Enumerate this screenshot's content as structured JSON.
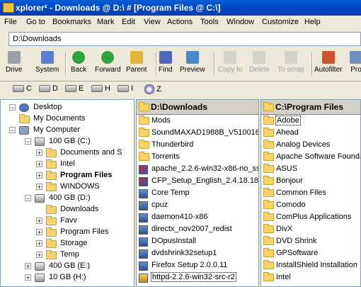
{
  "window": {
    "title": "xplorer² - Downloads @ D:\\ # [Program Files @ C:\\]"
  },
  "menu": [
    "File",
    "Go to",
    "Bookmarks",
    "Mark",
    "Edit",
    "View",
    "Actions",
    "Tools",
    "Window",
    "Customize",
    "Help"
  ],
  "address": {
    "value": "D:\\Downloads"
  },
  "toolbar": [
    {
      "label": "Drive",
      "icon": "drive-icon",
      "enabled": true
    },
    {
      "label": "System",
      "icon": "system-icon",
      "enabled": true
    },
    {
      "label": "Back",
      "icon": "back-arrow-icon",
      "enabled": true
    },
    {
      "label": "Forward",
      "icon": "forward-arrow-icon",
      "enabled": true
    },
    {
      "label": "Parent",
      "icon": "parent-folder-icon",
      "enabled": true
    },
    {
      "label": "Find",
      "icon": "binoculars-icon",
      "enabled": true
    },
    {
      "label": "Preview",
      "icon": "preview-icon",
      "enabled": true
    },
    {
      "label": "Copy to",
      "icon": "copy-to-icon",
      "enabled": false
    },
    {
      "label": "Delete",
      "icon": "delete-icon",
      "enabled": false
    },
    {
      "label": "To scrap",
      "icon": "scrap-icon",
      "enabled": false
    },
    {
      "label": "Autofilter",
      "icon": "filter-funnel-icon",
      "enabled": true
    },
    {
      "label": "Pro",
      "icon": "properties-icon",
      "enabled": true
    }
  ],
  "drives": [
    "C",
    "D",
    "E",
    "H",
    "I",
    "Z"
  ],
  "tree": [
    {
      "label": "Desktop",
      "level": 0,
      "expander": "−",
      "icon": "desktop-icon"
    },
    {
      "label": "My Documents",
      "level": 1,
      "expander": "",
      "icon": "folder-icon"
    },
    {
      "label": "My Computer",
      "level": 1,
      "expander": "−",
      "icon": "computer-icon"
    },
    {
      "label": "100 GB (C:)",
      "level": 2,
      "expander": "−",
      "icon": "drive-icon"
    },
    {
      "label": "Documents and S",
      "level": 3,
      "expander": "+",
      "icon": "folder-icon"
    },
    {
      "label": "Intel",
      "level": 3,
      "expander": "+",
      "icon": "folder-icon"
    },
    {
      "label": "Program Files",
      "level": 3,
      "expander": "+",
      "icon": "folder-icon",
      "bold": true
    },
    {
      "label": "WINDOWS",
      "level": 3,
      "expander": "+",
      "icon": "folder-icon"
    },
    {
      "label": "400 GB (D:)",
      "level": 2,
      "expander": "−",
      "icon": "drive-icon"
    },
    {
      "label": "Downloads",
      "level": 3,
      "expander": "",
      "icon": "folder-icon"
    },
    {
      "label": "Favv",
      "level": 3,
      "expander": "+",
      "icon": "folder-icon"
    },
    {
      "label": "Program Files",
      "level": 3,
      "expander": "+",
      "icon": "folder-icon"
    },
    {
      "label": "Storage",
      "level": 3,
      "expander": "+",
      "icon": "folder-icon"
    },
    {
      "label": "Temp",
      "level": 3,
      "expander": "+",
      "icon": "folder-icon"
    },
    {
      "label": "400 GB (E:)",
      "level": 2,
      "expander": "+",
      "icon": "drive-icon"
    },
    {
      "label": "10 GB (H:)",
      "level": 2,
      "expander": "+",
      "icon": "drive-icon"
    }
  ],
  "mid_pane": {
    "header": "D:\\Downloads",
    "items": [
      {
        "name": "Mods",
        "icon": "folder"
      },
      {
        "name": "SoundMAXAD1988B_V5100161:",
        "icon": "folder"
      },
      {
        "name": "Thunderbird",
        "icon": "folder"
      },
      {
        "name": "Torrents",
        "icon": "folder"
      },
      {
        "name": "apache_2.2.6-win32-x86-no_ss",
        "icon": "installer"
      },
      {
        "name": "CFP_Setup_English_2.4.18.184",
        "icon": "installer"
      },
      {
        "name": "Core Temp",
        "icon": "app"
      },
      {
        "name": "cpuz",
        "icon": "app"
      },
      {
        "name": "daemon410-x86",
        "icon": "app"
      },
      {
        "name": "directx_nov2007_redist",
        "icon": "app"
      },
      {
        "name": "DOpusInstall",
        "icon": "app"
      },
      {
        "name": "dvdshrink32setup1",
        "icon": "app"
      },
      {
        "name": "Firefox Setup 2.0.0.11",
        "icon": "app"
      },
      {
        "name": "httpd-2.2.6-win32-src-r2",
        "icon": "zip",
        "focused": true
      }
    ]
  },
  "right_pane": {
    "header": "C:\\Program Files",
    "items": [
      "Adobe",
      "Ahead",
      "Analog Devices",
      "Apache Software Founda",
      "ASUS",
      "Bonjour",
      "Common Files",
      "Comodo",
      "ComPlus Applications",
      "DivX",
      "DVD Shrink",
      "GPSoftware",
      "InstallShield Installation In",
      "Intel"
    ],
    "selected_index": 0
  }
}
